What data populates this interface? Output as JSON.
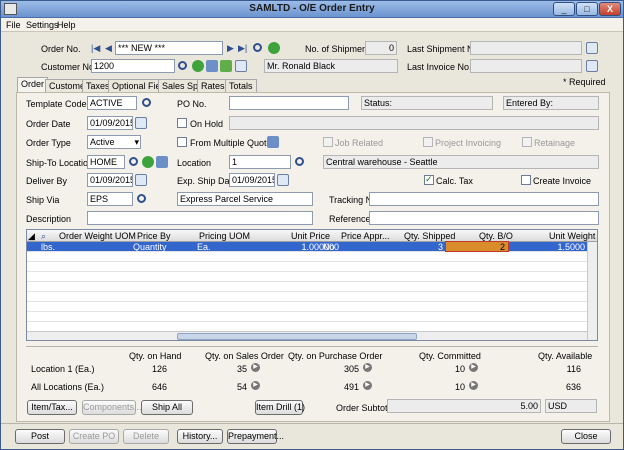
{
  "window": {
    "title": "SAMLTD - O/E Order Entry",
    "min": "_",
    "max": "□",
    "close": "X"
  },
  "menu": {
    "file": "File",
    "settings": "Settings",
    "help": "Help"
  },
  "header": {
    "order_no_label": "Order No.",
    "order_no_value": "*** NEW ***",
    "customer_no_label": "Customer No. *",
    "customer_no_value": "1200",
    "customer_name": "Mr. Ronald Black",
    "shipments_label": "No. of Shipments",
    "shipments_value": "0",
    "last_shipment_label": "Last Shipment No.",
    "last_shipment_value": "",
    "last_invoice_label": "Last Invoice No.",
    "last_invoice_value": "",
    "required_note": "*  Required"
  },
  "tabs": [
    "Order",
    "Customer",
    "Taxes",
    "Optional Fields",
    "Sales Split",
    "Rates",
    "Totals"
  ],
  "form": {
    "template_code_label": "Template Code",
    "template_code": "ACTIVE",
    "po_no_label": "PO No.",
    "po_no": "",
    "status_label": "Status:",
    "entered_by_label": "Entered By:",
    "order_date_label": "Order Date",
    "order_date": "01/09/2015",
    "on_hold_label": "On Hold",
    "order_type_label": "Order Type",
    "order_type": "Active",
    "from_quotes_label": "From Multiple Quotes",
    "job_related_label": "Job Related",
    "project_invoicing_label": "Project Invoicing",
    "retainage_label": "Retainage",
    "ship_to_label": "Ship-To Location",
    "ship_to": "HOME",
    "location_label": "Location",
    "location": "1",
    "location_desc": "Central warehouse - Seattle",
    "deliver_by_label": "Deliver By",
    "deliver_by": "01/09/2015",
    "exp_ship_label": "Exp. Ship Date",
    "exp_ship": "01/09/2015",
    "calc_tax_label": "Calc. Tax",
    "create_invoice_label": "Create Invoice",
    "ship_via_label": "Ship Via",
    "ship_via": "EPS",
    "ship_via_desc": "Express Parcel Service",
    "tracking_label": "Tracking No.",
    "tracking": "",
    "description_label": "Description",
    "description": "",
    "reference_label": "Reference",
    "reference": ""
  },
  "grid": {
    "headers": [
      "Order Weight UOM",
      "Price By",
      "Pricing UOM",
      "Unit Price",
      "Price Appr...",
      "Qty. Shipped",
      "Qty. B/O",
      "Unit Weight"
    ],
    "row": [
      "lbs.",
      "Quantity",
      "Ea.",
      "1.000000",
      "No",
      "3",
      "2",
      "1.5000"
    ]
  },
  "summary": {
    "headers": [
      "Qty. on Hand",
      "Qty. on Sales Order",
      "Qty. on Purchase Order",
      "Qty. Committed",
      "Qty. Available"
    ],
    "rows": [
      {
        "label": "Location  1 (Ea.)",
        "values": [
          "126",
          "35",
          "305",
          "10",
          "116"
        ]
      },
      {
        "label": "All Locations (Ea.)",
        "values": [
          "646",
          "54",
          "491",
          "10",
          "636"
        ]
      }
    ]
  },
  "buttons": {
    "item_tax": "Item/Tax...",
    "components": "Components...",
    "ship_all": "Ship All",
    "item_drill": "Item Drill (1)",
    "subtotal_label": "Order Subtotal",
    "subtotal": "5.00",
    "currency": "USD",
    "post": "Post",
    "create_po": "Create PO",
    "delete": "Delete",
    "history": "History...",
    "prepayment": "Prepayment...",
    "close": "Close"
  },
  "colors": {
    "selected_row": "#3366cc",
    "bo_cell": "#d88c2a"
  }
}
